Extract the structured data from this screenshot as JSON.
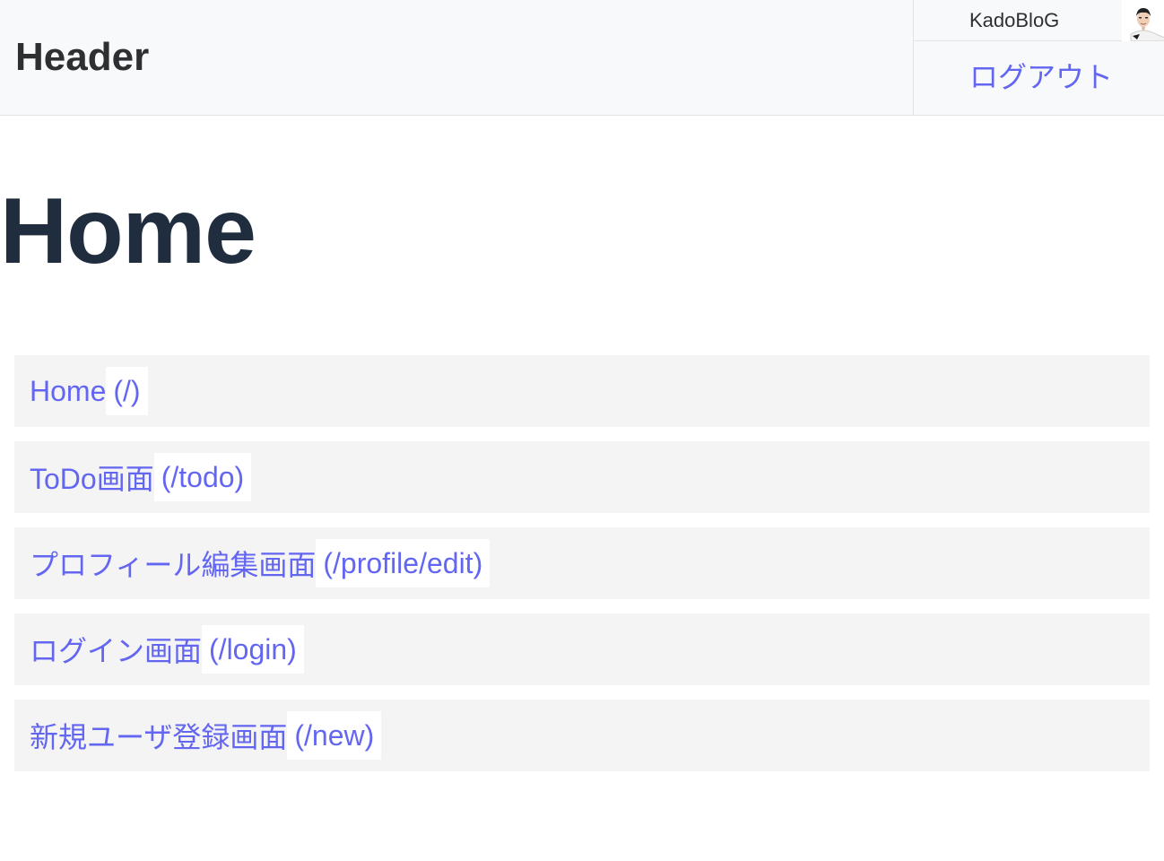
{
  "header": {
    "title": "Header",
    "username": "KadoBloG",
    "logout_label": "ログアウト"
  },
  "main": {
    "title": "Home",
    "nav_items": [
      {
        "label": "Home",
        "path": "(/)"
      },
      {
        "label": "ToDo画面",
        "path": "(/todo)"
      },
      {
        "label": "プロフィール編集画面",
        "path": "(/profile/edit)"
      },
      {
        "label": "ログイン画面",
        "path": "(/login)"
      },
      {
        "label": "新規ユーザ登録画面",
        "path": "(/new)"
      }
    ]
  },
  "colors": {
    "link": "#6366f1",
    "header_bg": "#f8f9fa",
    "item_bg": "#f4f4f4",
    "title": "#1f2d3f"
  },
  "icons": {
    "avatar": "user-avatar-photo"
  }
}
